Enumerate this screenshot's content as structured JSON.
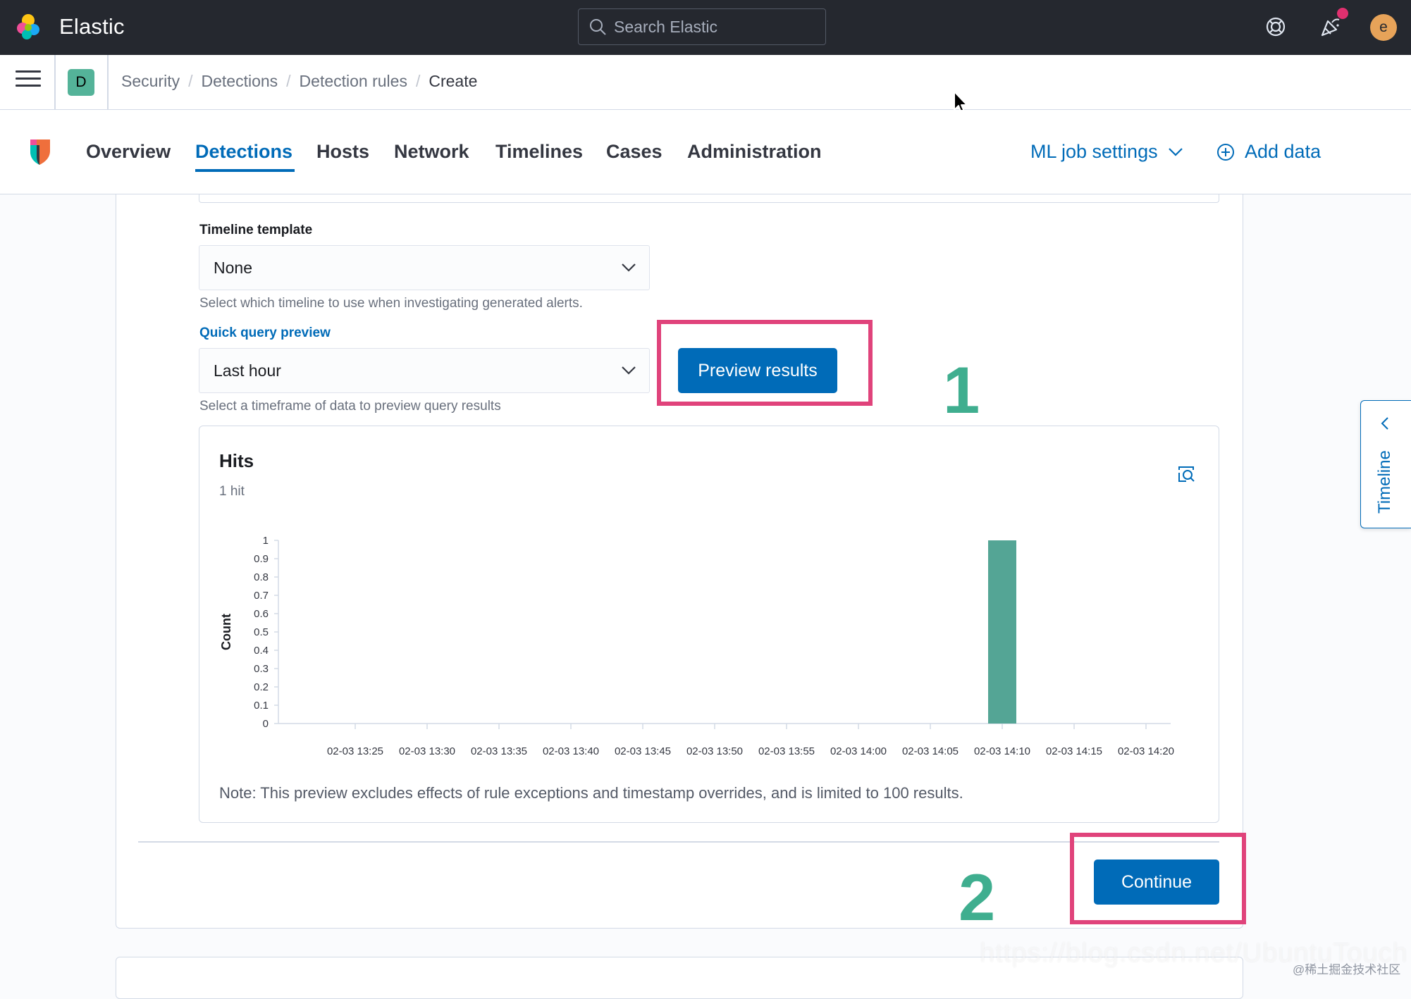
{
  "header": {
    "brand": "Elastic",
    "search_placeholder": "Search Elastic",
    "avatar_initial": "e"
  },
  "breadcrumbs": {
    "space_initial": "D",
    "items": [
      "Security",
      "Detections",
      "Detection rules",
      "Create"
    ]
  },
  "nav": {
    "tabs": [
      "Overview",
      "Detections",
      "Hosts",
      "Network",
      "Timelines",
      "Cases",
      "Administration"
    ],
    "active_tab": "Detections",
    "ml_settings": "ML job settings",
    "add_data": "Add data"
  },
  "form": {
    "timeline_template": {
      "label": "Timeline template",
      "value": "None",
      "help": "Select which timeline to use when investigating generated alerts."
    },
    "quick_query_preview": {
      "label": "Quick query preview",
      "value": "Last hour",
      "help": "Select a timeframe of data to preview query results",
      "button": "Preview results"
    },
    "continue_button": "Continue"
  },
  "annotations": {
    "step1": "1",
    "step2": "2",
    "highlight_color": "#e0437b",
    "number_color": "#3fae8f"
  },
  "hits": {
    "title": "Hits",
    "count_label": "1 hit",
    "note": "Note: This preview excludes effects of rule exceptions and timestamp overrides, and is limited to 100 results."
  },
  "chart_data": {
    "type": "bar",
    "ylabel": "Count",
    "xlabel": "",
    "ylim": [
      0,
      1
    ],
    "yticks": [
      "0",
      "0.1",
      "0.2",
      "0.3",
      "0.4",
      "0.5",
      "0.6",
      "0.7",
      "0.8",
      "0.9",
      "1"
    ],
    "xticks": [
      "02-03 13:25",
      "02-03 13:30",
      "02-03 13:35",
      "02-03 13:40",
      "02-03 13:45",
      "02-03 13:50",
      "02-03 13:55",
      "02-03 14:00",
      "02-03 14:05",
      "02-03 14:10",
      "02-03 14:15",
      "02-03 14:20"
    ],
    "bars": [
      {
        "x": "02-03 14:10",
        "value": 1
      }
    ],
    "bar_color": "#54a595",
    "grid": false
  },
  "timeline_flyout": {
    "label": "Timeline"
  },
  "colors": {
    "primary": "#006bb8",
    "header_bg": "#25282f"
  },
  "watermarks": [
    "https://blog.csdn.net/UbuntuTouch",
    "@稀土掘金技术社区"
  ]
}
